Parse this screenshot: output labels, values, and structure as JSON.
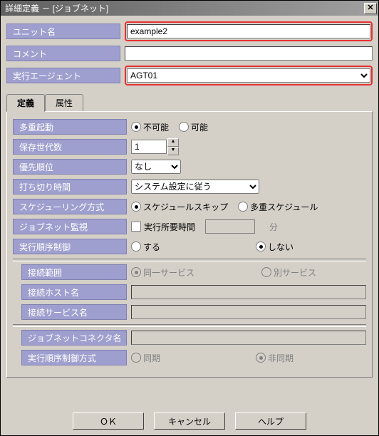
{
  "title": "詳細定義 － [ジョブネット]",
  "top": {
    "unit_name_label": "ユニット名",
    "unit_name_value": "example2",
    "comment_label": "コメント",
    "comment_value": "",
    "agent_label": "実行エージェント",
    "agent_value": "AGT01"
  },
  "tabs": {
    "def": "定義",
    "attr": "属性"
  },
  "panel": {
    "multi_label": "多重起動",
    "multi_no": "不可能",
    "multi_yes": "可能",
    "gen_label": "保存世代数",
    "gen_value": "1",
    "prio_label": "優先順位",
    "prio_value": "なし",
    "cutoff_label": "打ち切り時間",
    "cutoff_value": "システム設定に従う",
    "sched_label": "スケジューリング方式",
    "sched_skip": "スケジュールスキップ",
    "sched_multi": "多重スケジュール",
    "mon_label": "ジョブネット監視",
    "mon_check": "実行所要時間",
    "mon_unit": "分",
    "order_label": "実行順序制御",
    "order_yes": "する",
    "order_no": "しない",
    "scope_label": "接続範囲",
    "scope_same": "同一サービス",
    "scope_other": "別サービス",
    "host_label": "接続ホスト名",
    "service_label": "接続サービス名",
    "connector_label": "ジョブネットコネクタ名",
    "sync_label": "実行順序制御方式",
    "sync_yes": "同期",
    "sync_no": "非同期"
  },
  "buttons": {
    "ok": "ＯＫ",
    "cancel": "キャンセル",
    "help": "ヘルプ"
  }
}
